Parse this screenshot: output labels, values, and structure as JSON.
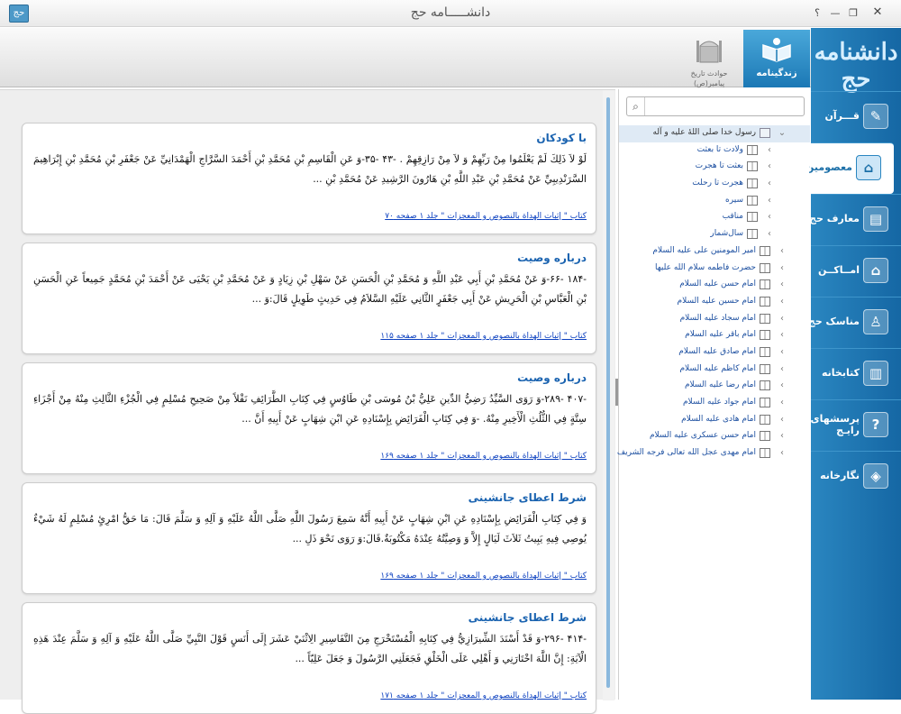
{
  "window": {
    "title": "دانشـــــامه حج",
    "help_label": "؟",
    "app_icon_text": "حج"
  },
  "ribbon": {
    "tabs": [
      {
        "label": "زندگینامه",
        "active": true
      },
      {
        "label": "حوادث تاریخ پیامبر(ص)",
        "active": false
      }
    ]
  },
  "sidebar": {
    "logo_text": "دانشنامه حج",
    "items": [
      {
        "label": "قـــرآن",
        "icon": "quran-icon",
        "glyph": "✎"
      },
      {
        "label": "معصومین",
        "icon": "shrine-icon",
        "glyph": "⌂",
        "active": true
      },
      {
        "label": "معارف حج",
        "icon": "book-icon",
        "glyph": "▤"
      },
      {
        "label": "امــاکــن",
        "icon": "mosque-icon",
        "glyph": "⌂"
      },
      {
        "label": "مناسک حج",
        "icon": "pilgrim-icon",
        "glyph": "♙"
      },
      {
        "label": "کتابخانه",
        "icon": "books-icon",
        "glyph": "▥"
      },
      {
        "label": "پرسشهای رایـج",
        "icon": "question-icon",
        "glyph": "?"
      },
      {
        "label": "نگارخانه",
        "icon": "gallery-icon",
        "glyph": "◈"
      }
    ]
  },
  "search": {
    "placeholder": "",
    "value": ""
  },
  "tree": [
    {
      "label": "رسول خدا صلی اللهٔ علیه و آله",
      "level": 0,
      "expanded": true,
      "root": true
    },
    {
      "label": "ولادت تا بعثت",
      "level": 1
    },
    {
      "label": "بعثت تا هجرت",
      "level": 1
    },
    {
      "label": "هجرت تا رحلت",
      "level": 1
    },
    {
      "label": "سیره",
      "level": 1
    },
    {
      "label": "مناقب",
      "level": 1
    },
    {
      "label": "سال‌شمار",
      "level": 1
    },
    {
      "label": "امیر المومنین علی علیه السلام",
      "level": 0
    },
    {
      "label": "حضرت فاطمه سلام الله علیها",
      "level": 0
    },
    {
      "label": "امام حسن علیه السلام",
      "level": 0
    },
    {
      "label": "امام حسین علیه السلام",
      "level": 0
    },
    {
      "label": "امام سجاد علیه السلام",
      "level": 0
    },
    {
      "label": "امام باقر علیه السلام",
      "level": 0
    },
    {
      "label": "امام صادق علیه السلام",
      "level": 0
    },
    {
      "label": "امام کاظم علیه السلام",
      "level": 0
    },
    {
      "label": "امام رضا علیه السلام",
      "level": 0
    },
    {
      "label": "امام جواد علیه السلام",
      "level": 0
    },
    {
      "label": "امام هادی علیه السلام",
      "level": 0
    },
    {
      "label": "امام حسن عسکری علیه السلام",
      "level": 0
    },
    {
      "label": "امام مهدی عجل الله تعالی فرجه الشریف",
      "level": 0
    }
  ],
  "cards": [
    {
      "title": "با کودکان",
      "body": "لَوْ لاَ ذَلِكَ لَمْ يَعْلَمُوا مِنْ رَبِّهِمْ وَ لاَ مِنْ رَازِقِهِمْ . -۴۳ -۳۵-وَ عَنِ الْقَاسِمِ بْنِ مُحَمَّدِ بْنِ أَحْمَدَ السَّرَّاجِ الْهَمْدَانِيِّ عَنْ جَعْفَرِ بْنِ مُحَمَّدِ بْنِ إِبْرَاهِيمَ السَّرَنْدِيبِيِّ عَنْ مُحَمَّدِ بْنِ عَبْدِ اللَّهِ بْنِ هَارُونَ الرَّشِيدِ عَنْ مُحَمَّدِ بْنِ ...",
      "ref": "کتاب \" إثبات الهداة بالنصوص و المعجزات \" جلد ۱ صفحه ۷۰"
    },
    {
      "title": "درباره وصیت",
      "body": "-۱۸۴ -۶۶-وَ عَنْ مُحَمَّدِ بْنِ أَبِي عَبْدِ اللَّهِ وَ مُحَمَّدِ بْنِ الْحَسَنِ عَنْ سَهْلِ بْنِ زِيَادٍ وَ عَنْ مُحَمَّدِ بْنِ يَحْيَى عَنْ أَحْمَدَ بْنِ مُحَمَّدٍ جَمِيعاً عَنِ الْحَسَنِ بْنِ الْعَبَّاسِ بْنِ الْحَرِيشِ عَنْ أَبِي جَعْفَرٍ الثَّانِي عَلَيْهِ السَّلاَمُ فِي حَدِيثٍ طَوِيلٍ قَالَ:وَ ...",
      "ref": "کتاب \" إثبات الهداة بالنصوص و المعجزات \" جلد ۱ صفحه ۱۱۵"
    },
    {
      "title": "درباره وصیت",
      "body": "-۴۰۷ -۲۸۹-وَ رَوَى السَّيِّدُ رَضِيُّ الدِّينِ عَلِيُّ بْنُ مُوسَى بْنِ طَاوُسٍ فِي كِتَابِ الطَّرَائِفِ نَقْلاً مِنْ صَحِيحِ مُسْلِمٍ فِي الْجُزْءِ الثَّالِثِ مِنْهُ مِنْ أَجْزَاءِ سِتَّةٍ فِي الثُّلُثِ الْأَخِيرِ مِنْهُ. -وَ فِي كِتَابِ الْفَرَائِضِ بِإِسْنَادِهِ عَنِ ابْنِ شِهَابٍ عَنْ أَبِيهِ أَنَّ ...",
      "ref": "کتاب \" إثبات الهداة بالنصوص و المعجزات \" جلد ۱ صفحه ۱۶۹"
    },
    {
      "title": "شرط اعطای جانشینی",
      "body": "وَ فِي كِتَابِ الْفَرَائِضِ بِإِسْنَادِهِ عَنِ ابْنِ شِهَابٍ عَنْ أَبِيهِ أَنَّهُ سَمِعَ رَسُولَ اللَّهِ صَلَّى اللَّهُ عَلَيْهِ وَ آلِهِ وَ سَلَّمَ قَالَ: مَا حَقُّ امْرِئٍ مُسْلِمٍ لَهُ شَيْءٌ يُوصِي فِيهِ يَبِيتُ ثَلاَثَ لَيَالٍ إِلاَّ وَ وَصِيَّتُهُ عِنْدَهُ مَكْتُوبَةٌ.قَالَ:وَ رَوَى نَحْوَ ذَلِ ...",
      "ref": "کتاب \" إثبات الهداة بالنصوص و المعجزات \" جلد ۱ صفحه ۱۶۹"
    },
    {
      "title": "شرط اعطای جانشینی",
      "body": "-۴۱۴ -۲۹۶-وَ قَدْ أَسْنَدَ الشِّيرَازِيُّ فِي كِتَابِهِ الْمُسْتَخْرَجِ مِنَ التَّفَاسِيرِ الِاثْنَيْ عَشَرَ إِلَى أَنَسٍ قَوْلَ النَّبِيِّ صَلَّى اللَّهُ عَلَيْهِ وَ آلِهِ وَ سَلَّمَ عِنْدَ هَذِهِ الْآيَةِ: إِنَّ اللَّهَ اخْتَارَنِي وَ أَهْلِي عَلَى الْخَلْقِ فَجَعَلَنِي الرَّسُولَ وَ جَعَلَ عَلِيّاً ...",
      "ref": "کتاب \" إثبات الهداة بالنصوص و المعجزات \" جلد ۱ صفحه ۱۷۱"
    }
  ]
}
